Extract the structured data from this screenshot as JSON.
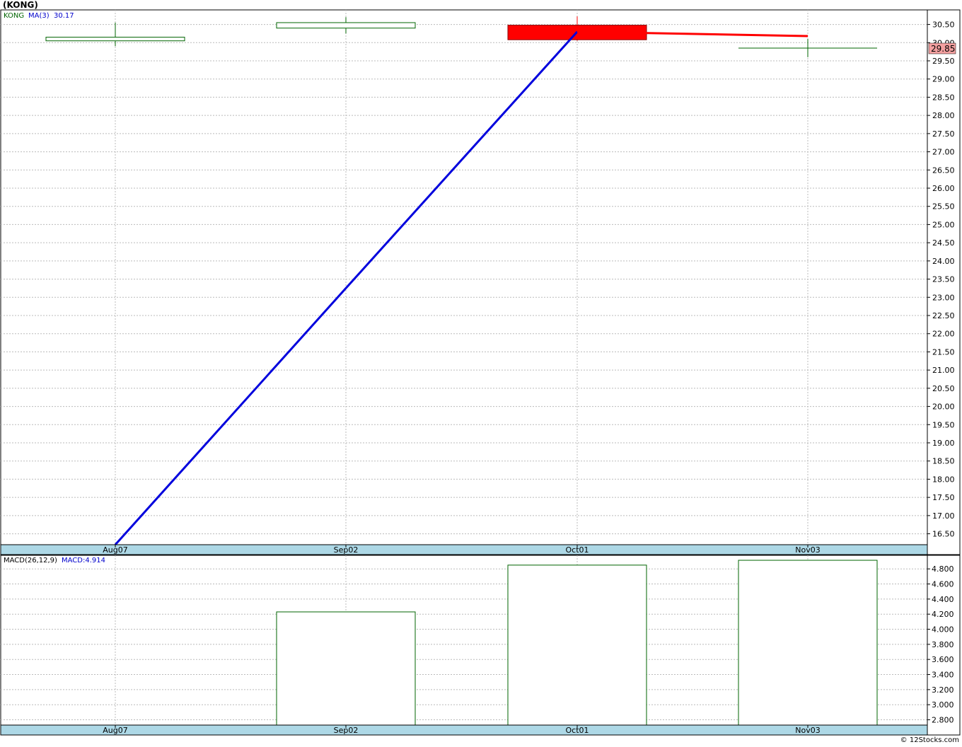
{
  "title": "(KONG)",
  "footer": "© 12Stocks.com",
  "chart_data": [
    {
      "type": "candlestick",
      "legend": {
        "symbol": "KONG",
        "ma_label": "MA(3)",
        "ma_value": "30.17"
      },
      "x_labels": [
        "Aug07",
        "Sep02",
        "Oct01",
        "Nov03"
      ],
      "ylim": [
        16.2,
        30.9
      ],
      "y_ticks": [
        "16.50",
        "17.00",
        "17.50",
        "18.00",
        "18.50",
        "19.00",
        "19.50",
        "20.00",
        "20.50",
        "21.00",
        "21.50",
        "22.00",
        "22.50",
        "23.00",
        "23.50",
        "24.00",
        "24.50",
        "25.00",
        "25.50",
        "26.00",
        "26.50",
        "27.00",
        "27.50",
        "28.00",
        "28.50",
        "29.00",
        "29.50",
        "30.00",
        "30.50"
      ],
      "candles": [
        {
          "x": "Aug07",
          "open": 30.05,
          "high": 30.55,
          "low": 29.9,
          "close": 30.15,
          "color": "#006400",
          "filled": false
        },
        {
          "x": "Sep02",
          "open": 30.4,
          "high": 30.7,
          "low": 30.25,
          "close": 30.55,
          "color": "#006400",
          "filled": false
        },
        {
          "x": "Oct01",
          "open": 30.48,
          "high": 30.72,
          "low": 30.05,
          "close": 30.08,
          "color": "#ff0000",
          "filled": true
        },
        {
          "x": "Nov03",
          "open": 29.85,
          "high": 30.1,
          "low": 29.6,
          "close": 29.85,
          "color": "#006400",
          "filled": false
        }
      ],
      "ma_line": {
        "color": "#0000dd",
        "x": [
          "Aug07",
          "Sep02",
          "Oct01"
        ],
        "y": [
          16.2,
          23.25,
          30.3
        ]
      },
      "red_line": {
        "color": "#ff0000",
        "x": [
          "Oct01",
          "Nov03"
        ],
        "y": [
          30.3,
          30.18
        ]
      },
      "last_price": {
        "label": "29.85",
        "value": 29.85,
        "bg": "#f4a0a0"
      },
      "grid": true
    },
    {
      "type": "bar",
      "legend": {
        "name": "MACD(26,12,9)",
        "value_label": "MACD:4.914"
      },
      "x_labels": [
        "Aug07",
        "Sep02",
        "Oct01",
        "Nov03"
      ],
      "ylim": [
        2.73,
        4.98
      ],
      "y_ticks": [
        "2.800",
        "3.000",
        "3.200",
        "3.400",
        "3.600",
        "3.800",
        "4.000",
        "4.200",
        "4.400",
        "4.600",
        "4.800"
      ],
      "categories": [
        "Sep02",
        "Oct01",
        "Nov03"
      ],
      "values": [
        4.23,
        4.85,
        4.914
      ],
      "bar_color": "#006400",
      "grid": true
    }
  ],
  "colors": {
    "axis_band": "#add8e6",
    "grid": "#bbbbbb",
    "legend_symbol": "#006400",
    "legend_value": "#0000cc"
  }
}
